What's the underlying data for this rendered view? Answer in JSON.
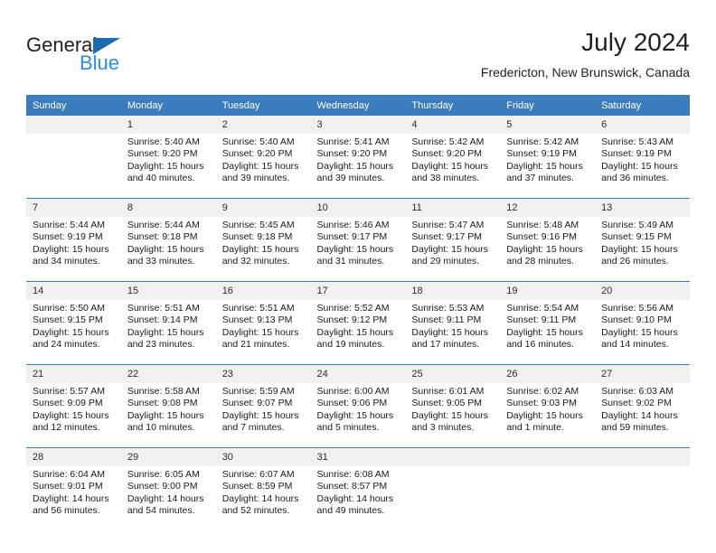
{
  "brand": {
    "name_part1": "General",
    "name_part2": "Blue",
    "flag_color": "#1c6bb0",
    "blue_color": "#2e8fd6"
  },
  "header": {
    "title": "July 2024",
    "location": "Fredericton, New Brunswick, Canada"
  },
  "theme": {
    "header_bg": "#3a7cbe",
    "header_text": "#ffffff",
    "daynum_bg": "#f0f0f0",
    "cell_bg": "#ffffff",
    "separator": "#3a7cbe"
  },
  "weekday_headers": [
    "Sunday",
    "Monday",
    "Tuesday",
    "Wednesday",
    "Thursday",
    "Friday",
    "Saturday"
  ],
  "weeks": [
    {
      "days": [
        {
          "num": "",
          "lines": []
        },
        {
          "num": "1",
          "lines": [
            "Sunrise: 5:40 AM",
            "Sunset: 9:20 PM",
            "Daylight: 15 hours",
            "and 40 minutes."
          ]
        },
        {
          "num": "2",
          "lines": [
            "Sunrise: 5:40 AM",
            "Sunset: 9:20 PM",
            "Daylight: 15 hours",
            "and 39 minutes."
          ]
        },
        {
          "num": "3",
          "lines": [
            "Sunrise: 5:41 AM",
            "Sunset: 9:20 PM",
            "Daylight: 15 hours",
            "and 39 minutes."
          ]
        },
        {
          "num": "4",
          "lines": [
            "Sunrise: 5:42 AM",
            "Sunset: 9:20 PM",
            "Daylight: 15 hours",
            "and 38 minutes."
          ]
        },
        {
          "num": "5",
          "lines": [
            "Sunrise: 5:42 AM",
            "Sunset: 9:19 PM",
            "Daylight: 15 hours",
            "and 37 minutes."
          ]
        },
        {
          "num": "6",
          "lines": [
            "Sunrise: 5:43 AM",
            "Sunset: 9:19 PM",
            "Daylight: 15 hours",
            "and 36 minutes."
          ]
        }
      ]
    },
    {
      "days": [
        {
          "num": "7",
          "lines": [
            "Sunrise: 5:44 AM",
            "Sunset: 9:19 PM",
            "Daylight: 15 hours",
            "and 34 minutes."
          ]
        },
        {
          "num": "8",
          "lines": [
            "Sunrise: 5:44 AM",
            "Sunset: 9:18 PM",
            "Daylight: 15 hours",
            "and 33 minutes."
          ]
        },
        {
          "num": "9",
          "lines": [
            "Sunrise: 5:45 AM",
            "Sunset: 9:18 PM",
            "Daylight: 15 hours",
            "and 32 minutes."
          ]
        },
        {
          "num": "10",
          "lines": [
            "Sunrise: 5:46 AM",
            "Sunset: 9:17 PM",
            "Daylight: 15 hours",
            "and 31 minutes."
          ]
        },
        {
          "num": "11",
          "lines": [
            "Sunrise: 5:47 AM",
            "Sunset: 9:17 PM",
            "Daylight: 15 hours",
            "and 29 minutes."
          ]
        },
        {
          "num": "12",
          "lines": [
            "Sunrise: 5:48 AM",
            "Sunset: 9:16 PM",
            "Daylight: 15 hours",
            "and 28 minutes."
          ]
        },
        {
          "num": "13",
          "lines": [
            "Sunrise: 5:49 AM",
            "Sunset: 9:15 PM",
            "Daylight: 15 hours",
            "and 26 minutes."
          ]
        }
      ]
    },
    {
      "days": [
        {
          "num": "14",
          "lines": [
            "Sunrise: 5:50 AM",
            "Sunset: 9:15 PM",
            "Daylight: 15 hours",
            "and 24 minutes."
          ]
        },
        {
          "num": "15",
          "lines": [
            "Sunrise: 5:51 AM",
            "Sunset: 9:14 PM",
            "Daylight: 15 hours",
            "and 23 minutes."
          ]
        },
        {
          "num": "16",
          "lines": [
            "Sunrise: 5:51 AM",
            "Sunset: 9:13 PM",
            "Daylight: 15 hours",
            "and 21 minutes."
          ]
        },
        {
          "num": "17",
          "lines": [
            "Sunrise: 5:52 AM",
            "Sunset: 9:12 PM",
            "Daylight: 15 hours",
            "and 19 minutes."
          ]
        },
        {
          "num": "18",
          "lines": [
            "Sunrise: 5:53 AM",
            "Sunset: 9:11 PM",
            "Daylight: 15 hours",
            "and 17 minutes."
          ]
        },
        {
          "num": "19",
          "lines": [
            "Sunrise: 5:54 AM",
            "Sunset: 9:11 PM",
            "Daylight: 15 hours",
            "and 16 minutes."
          ]
        },
        {
          "num": "20",
          "lines": [
            "Sunrise: 5:56 AM",
            "Sunset: 9:10 PM",
            "Daylight: 15 hours",
            "and 14 minutes."
          ]
        }
      ]
    },
    {
      "days": [
        {
          "num": "21",
          "lines": [
            "Sunrise: 5:57 AM",
            "Sunset: 9:09 PM",
            "Daylight: 15 hours",
            "and 12 minutes."
          ]
        },
        {
          "num": "22",
          "lines": [
            "Sunrise: 5:58 AM",
            "Sunset: 9:08 PM",
            "Daylight: 15 hours",
            "and 10 minutes."
          ]
        },
        {
          "num": "23",
          "lines": [
            "Sunrise: 5:59 AM",
            "Sunset: 9:07 PM",
            "Daylight: 15 hours",
            "and 7 minutes."
          ]
        },
        {
          "num": "24",
          "lines": [
            "Sunrise: 6:00 AM",
            "Sunset: 9:06 PM",
            "Daylight: 15 hours",
            "and 5 minutes."
          ]
        },
        {
          "num": "25",
          "lines": [
            "Sunrise: 6:01 AM",
            "Sunset: 9:05 PM",
            "Daylight: 15 hours",
            "and 3 minutes."
          ]
        },
        {
          "num": "26",
          "lines": [
            "Sunrise: 6:02 AM",
            "Sunset: 9:03 PM",
            "Daylight: 15 hours",
            "and 1 minute."
          ]
        },
        {
          "num": "27",
          "lines": [
            "Sunrise: 6:03 AM",
            "Sunset: 9:02 PM",
            "Daylight: 14 hours",
            "and 59 minutes."
          ]
        }
      ]
    },
    {
      "days": [
        {
          "num": "28",
          "lines": [
            "Sunrise: 6:04 AM",
            "Sunset: 9:01 PM",
            "Daylight: 14 hours",
            "and 56 minutes."
          ]
        },
        {
          "num": "29",
          "lines": [
            "Sunrise: 6:05 AM",
            "Sunset: 9:00 PM",
            "Daylight: 14 hours",
            "and 54 minutes."
          ]
        },
        {
          "num": "30",
          "lines": [
            "Sunrise: 6:07 AM",
            "Sunset: 8:59 PM",
            "Daylight: 14 hours",
            "and 52 minutes."
          ]
        },
        {
          "num": "31",
          "lines": [
            "Sunrise: 6:08 AM",
            "Sunset: 8:57 PM",
            "Daylight: 14 hours",
            "and 49 minutes."
          ]
        },
        {
          "num": "",
          "lines": []
        },
        {
          "num": "",
          "lines": []
        },
        {
          "num": "",
          "lines": []
        }
      ]
    }
  ]
}
